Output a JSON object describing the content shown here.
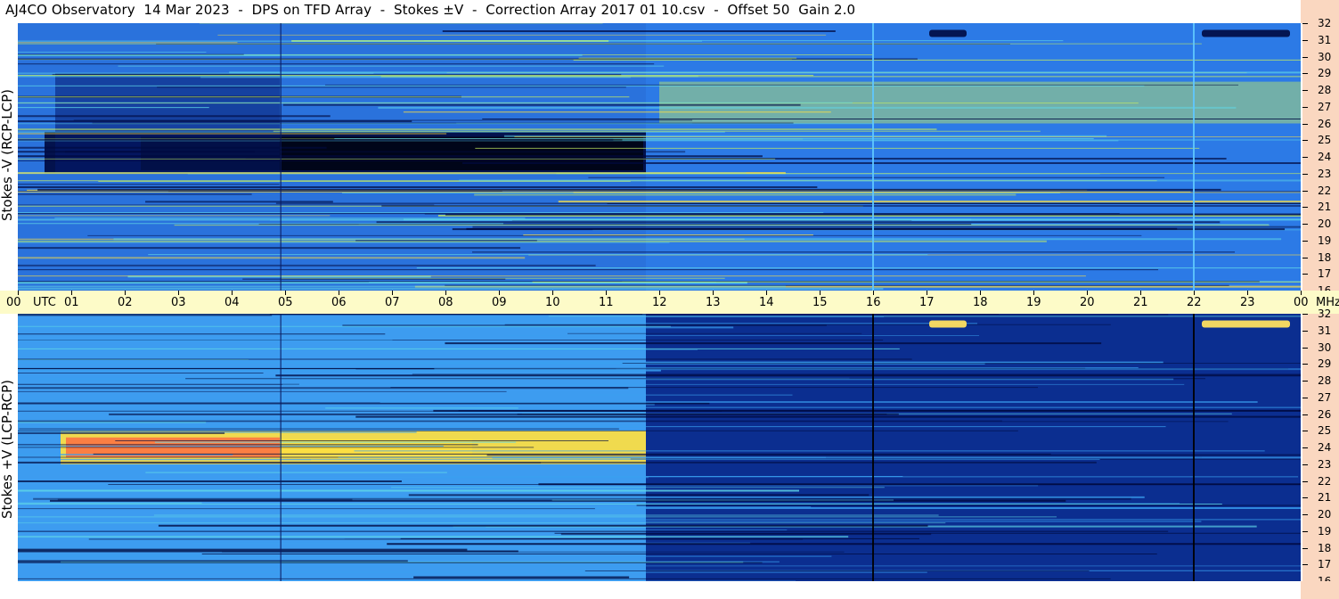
{
  "title": "AJ4CO Observatory  14 Mar 2023  -  DPS on TFD Array  -  Stokes ±V  -  Correction Array 2017 01 10.csv  -  Offset 50  Gain 2.0",
  "chart_data": [
    {
      "type": "heatmap",
      "panel": "top",
      "ylabel": "Stokes -V (RCP-LCP)",
      "x_ticks": [
        "00",
        "UTC",
        "01",
        "02",
        "03",
        "04",
        "05",
        "06",
        "07",
        "08",
        "09",
        "10",
        "11",
        "12",
        "13",
        "14",
        "15",
        "16",
        "17",
        "18",
        "19",
        "20",
        "21",
        "22",
        "23",
        "00",
        "MHz"
      ],
      "y_ticks": [
        "32",
        "31",
        "30",
        "29",
        "28",
        "27",
        "26",
        "25",
        "24",
        "23",
        "22",
        "21",
        "20",
        "19",
        "18",
        "17",
        "16"
      ],
      "x_range_hours": [
        0,
        24
      ],
      "y_range_mhz": [
        16,
        32
      ],
      "colormap": [
        "#000a40",
        "#00208a",
        "#1a5fd8",
        "#3aa0f0",
        "#60d8e8",
        "#c8f060",
        "#ffe040",
        "#ff6040"
      ],
      "features": [
        {
          "desc": "dark absorption band",
          "x_hours": [
            0.5,
            11.75
          ],
          "y_mhz": [
            23.0,
            25.5
          ],
          "intensity": "low"
        },
        {
          "desc": "bright noisy band",
          "x_hours": [
            12.0,
            24.0
          ],
          "y_mhz": [
            26.0,
            28.5
          ],
          "intensity": "high"
        }
      ]
    },
    {
      "type": "heatmap",
      "panel": "bottom",
      "ylabel": "Stokes +V (LCP-RCP)",
      "x_ticks": [
        "00",
        "UTC",
        "01",
        "02",
        "03",
        "04",
        "05",
        "06",
        "07",
        "08",
        "09",
        "10",
        "11",
        "12",
        "13",
        "14",
        "15",
        "16",
        "17",
        "18",
        "19",
        "20",
        "21",
        "22",
        "23",
        "00",
        "MHz"
      ],
      "y_ticks": [
        "32",
        "31",
        "30",
        "29",
        "28",
        "27",
        "26",
        "25",
        "24",
        "23",
        "22",
        "21",
        "20",
        "19",
        "18",
        "17",
        "16"
      ],
      "x_range_hours": [
        0,
        24
      ],
      "y_range_mhz": [
        16,
        32
      ],
      "colormap": [
        "#000a40",
        "#00208a",
        "#1a5fd8",
        "#3aa0f0",
        "#60d8e8",
        "#c8f060",
        "#ffe040",
        "#ff6040"
      ],
      "features": [
        {
          "desc": "bright emission band",
          "x_hours": [
            0.8,
            11.75
          ],
          "y_mhz": [
            23.0,
            25.0
          ],
          "intensity": "high"
        },
        {
          "desc": "dark striped region",
          "x_hours": [
            11.75,
            24.0
          ],
          "y_mhz": [
            16.0,
            32.0
          ],
          "intensity": "low"
        }
      ]
    }
  ]
}
